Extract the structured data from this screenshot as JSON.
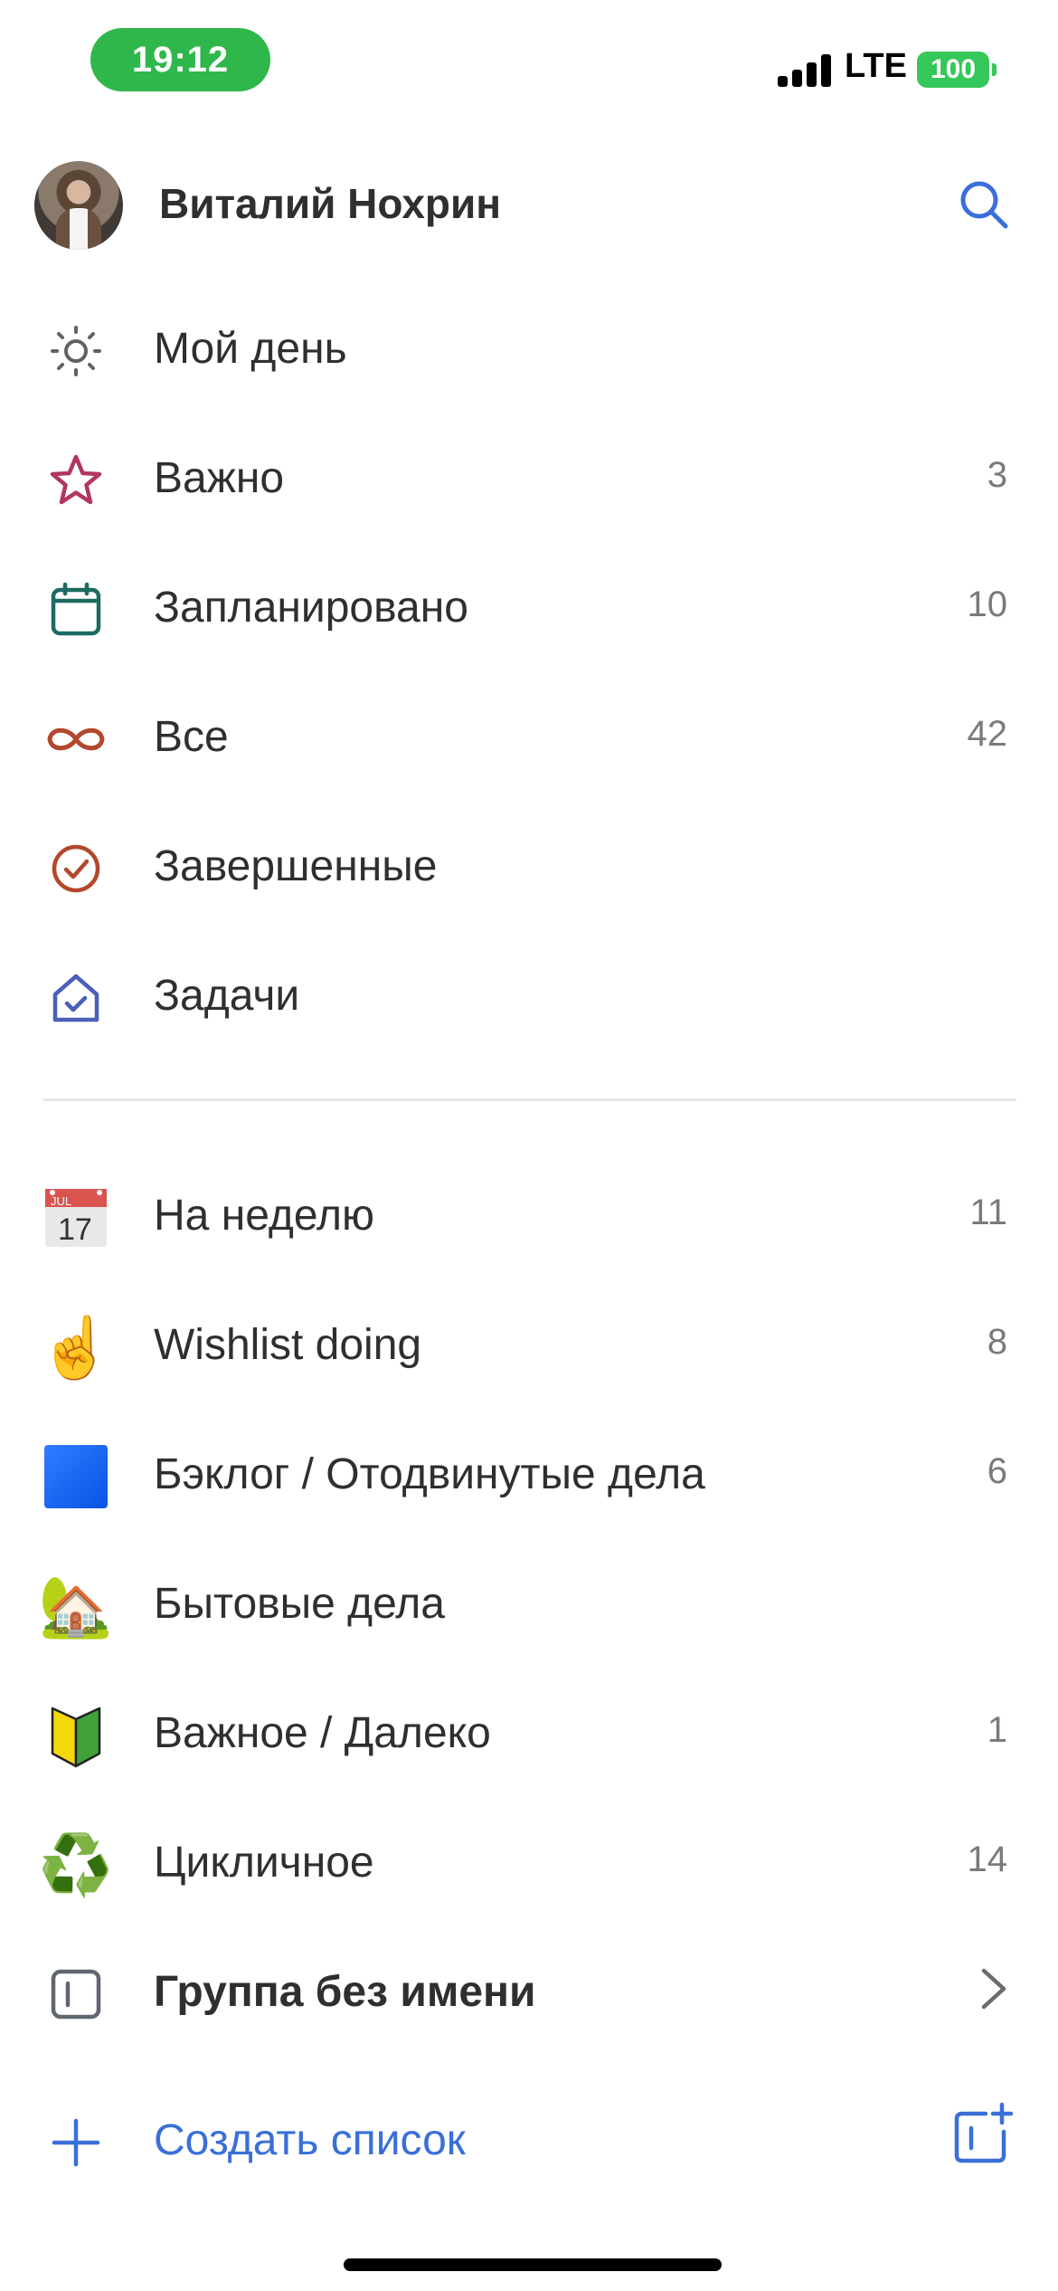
{
  "status_bar": {
    "time": "19:12",
    "network": "LTE",
    "battery": "100"
  },
  "profile": {
    "name": "Виталий Нохрин",
    "avatar_icon": "user-avatar",
    "search_icon": "search-icon"
  },
  "smart_lists": [
    {
      "label": "Мой день",
      "count": "",
      "icon": "sun-icon",
      "color": "#5f6368"
    },
    {
      "label": "Важно",
      "count": "3",
      "icon": "star-icon",
      "color": "#b2365f"
    },
    {
      "label": "Запланировано",
      "count": "10",
      "icon": "calendar-icon",
      "color": "#1c6b62"
    },
    {
      "label": "Все",
      "count": "42",
      "icon": "infinity-icon",
      "color": "#b3472c"
    },
    {
      "label": "Завершенные",
      "count": "",
      "icon": "check-circle-icon",
      "color": "#b3472c"
    },
    {
      "label": "Задачи",
      "count": "",
      "icon": "home-check-icon",
      "color": "#4b5fb8"
    }
  ],
  "user_lists": [
    {
      "label": "На неделю",
      "count": "11",
      "icon": "calendar-emoji-icon",
      "calendar_month": "JUL",
      "calendar_day": "17"
    },
    {
      "label": "Wishlist doing",
      "count": "8",
      "icon": "pointing-up-emoji-icon",
      "emoji": "☝️"
    },
    {
      "label": "Бэклог / Отодвинутые дела",
      "count": "6",
      "icon": "blue-square-emoji-icon",
      "emoji": "🟦"
    },
    {
      "label": "Бытовые дела",
      "count": "",
      "icon": "house-garden-emoji-icon",
      "emoji": "🏡"
    },
    {
      "label": "Важное / Далеко",
      "count": "1",
      "icon": "beginner-emoji-icon",
      "emoji": "🔰"
    },
    {
      "label": "Цикличное",
      "count": "14",
      "icon": "recycle-emoji-icon",
      "emoji": "♻️"
    }
  ],
  "group": {
    "label": "Группа без имени",
    "icon": "group-icon",
    "chevron_icon": "chevron-right-icon"
  },
  "create": {
    "label": "Создать список",
    "icon": "plus-icon",
    "new_group_icon": "new-group-icon",
    "accent": "#3a6fd9"
  }
}
